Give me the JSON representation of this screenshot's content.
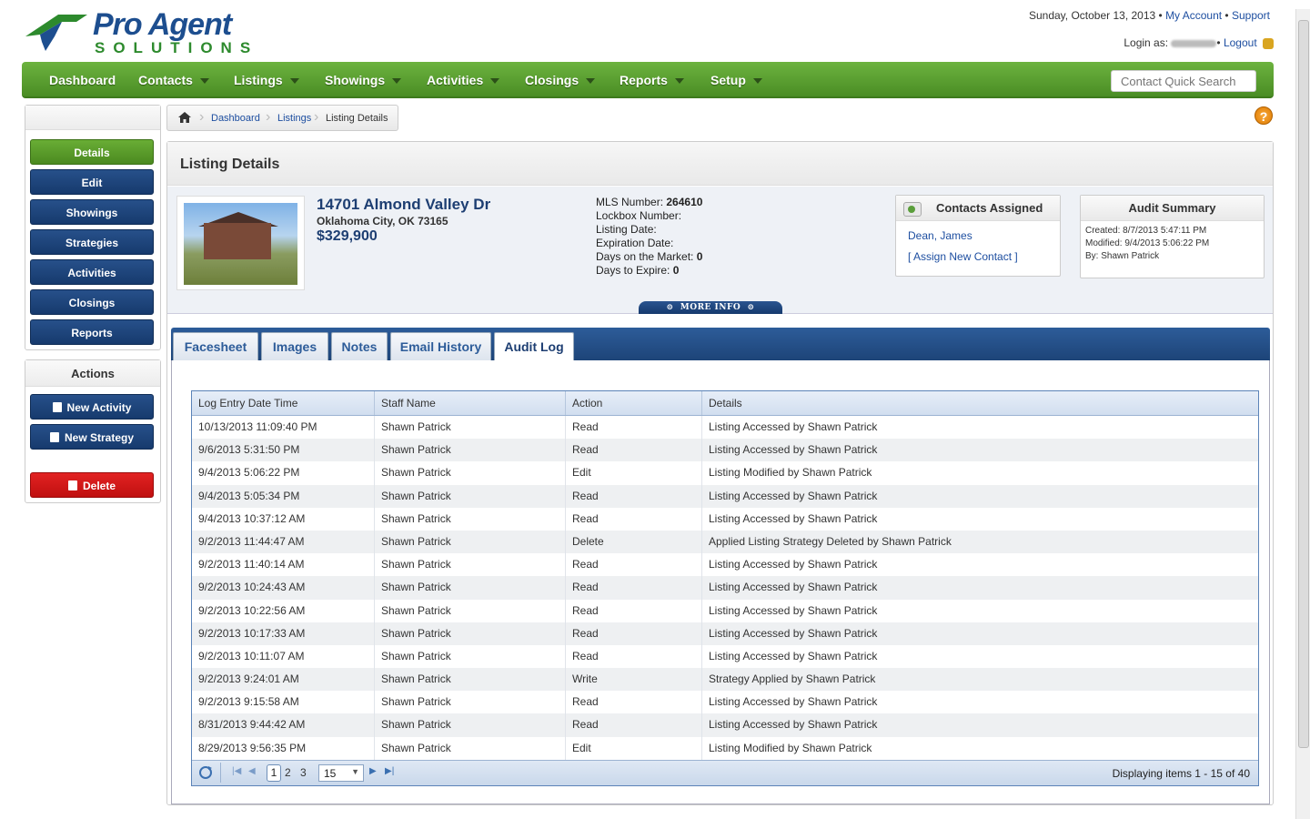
{
  "brand": {
    "line1": "Pro Agent",
    "line2": "SOLUTIONS"
  },
  "topbar": {
    "date": "Sunday, October 13, 2013",
    "my_account": "My Account",
    "support": "Support",
    "login_as": "Login as:",
    "logout": "Logout"
  },
  "nav": {
    "items": [
      {
        "label": "Dashboard"
      },
      {
        "label": "Contacts"
      },
      {
        "label": "Listings"
      },
      {
        "label": "Showings"
      },
      {
        "label": "Activities"
      },
      {
        "label": "Closings"
      },
      {
        "label": "Reports"
      },
      {
        "label": "Setup"
      }
    ],
    "search_placeholder": "Contact Quick Search"
  },
  "sidebar": {
    "items": [
      {
        "label": "Details"
      },
      {
        "label": "Edit"
      },
      {
        "label": "Showings"
      },
      {
        "label": "Strategies"
      },
      {
        "label": "Activities"
      },
      {
        "label": "Closings"
      },
      {
        "label": "Reports"
      }
    ]
  },
  "actions": {
    "title": "Actions",
    "new_activity": "New Activity",
    "new_strategy": "New Strategy",
    "delete": "Delete"
  },
  "breadcrumb": {
    "dashboard": "Dashboard",
    "listings": "Listings",
    "current": "Listing Details"
  },
  "help": "?",
  "panel": {
    "title": "Listing Details"
  },
  "listing": {
    "address": "14701 Almond Valley Dr",
    "city": "Oklahoma City, OK 73165",
    "price": "$329,900",
    "mls_label": "MLS Number:",
    "mls_value": "264610",
    "lockbox_label": "Lockbox Number:",
    "listing_date_label": "Listing Date:",
    "expiration_label": "Expiration Date:",
    "dom_label": "Days on the Market:",
    "dom_value": "0",
    "dte_label": "Days to Expire:",
    "dte_value": "0",
    "more_info": "MORE INFO"
  },
  "contacts": {
    "title": "Contacts Assigned",
    "contact": "Dean, James",
    "assign": "[ Assign New Contact ]"
  },
  "audit": {
    "title": "Audit Summary",
    "created": "Created: 8/7/2013 5:47:11 PM",
    "modified": "Modified: 9/4/2013 5:06:22 PM",
    "by": "By: Shawn Patrick"
  },
  "tabs": [
    {
      "label": "Facesheet"
    },
    {
      "label": "Images"
    },
    {
      "label": "Notes"
    },
    {
      "label": "Email History"
    },
    {
      "label": "Audit Log"
    }
  ],
  "grid": {
    "headers": [
      "Log Entry Date Time",
      "Staff Name",
      "Action",
      "Details"
    ],
    "rows": [
      [
        "10/13/2013 11:09:40 PM",
        "Shawn Patrick",
        "Read",
        "Listing Accessed by Shawn Patrick"
      ],
      [
        "9/6/2013 5:31:50 PM",
        "Shawn Patrick",
        "Read",
        "Listing Accessed by Shawn Patrick"
      ],
      [
        "9/4/2013 5:06:22 PM",
        "Shawn Patrick",
        "Edit",
        "Listing Modified by Shawn Patrick"
      ],
      [
        "9/4/2013 5:05:34 PM",
        "Shawn Patrick",
        "Read",
        "Listing Accessed by Shawn Patrick"
      ],
      [
        "9/4/2013 10:37:12 AM",
        "Shawn Patrick",
        "Read",
        "Listing Accessed by Shawn Patrick"
      ],
      [
        "9/2/2013 11:44:47 AM",
        "Shawn Patrick",
        "Delete",
        "Applied Listing Strategy Deleted by Shawn Patrick"
      ],
      [
        "9/2/2013 11:40:14 AM",
        "Shawn Patrick",
        "Read",
        "Listing Accessed by Shawn Patrick"
      ],
      [
        "9/2/2013 10:24:43 AM",
        "Shawn Patrick",
        "Read",
        "Listing Accessed by Shawn Patrick"
      ],
      [
        "9/2/2013 10:22:56 AM",
        "Shawn Patrick",
        "Read",
        "Listing Accessed by Shawn Patrick"
      ],
      [
        "9/2/2013 10:17:33 AM",
        "Shawn Patrick",
        "Read",
        "Listing Accessed by Shawn Patrick"
      ],
      [
        "9/2/2013 10:11:07 AM",
        "Shawn Patrick",
        "Read",
        "Listing Accessed by Shawn Patrick"
      ],
      [
        "9/2/2013 9:24:01 AM",
        "Shawn Patrick",
        "Write",
        "Strategy Applied by Shawn Patrick"
      ],
      [
        "9/2/2013 9:15:58 AM",
        "Shawn Patrick",
        "Read",
        "Listing Accessed by Shawn Patrick"
      ],
      [
        "8/31/2013 9:44:42 AM",
        "Shawn Patrick",
        "Read",
        "Listing Accessed by Shawn Patrick"
      ],
      [
        "8/29/2013 9:56:35 PM",
        "Shawn Patrick",
        "Edit",
        "Listing Modified by Shawn Patrick"
      ]
    ],
    "pager": {
      "pages": [
        "1",
        "2",
        "3"
      ],
      "page_size": "15",
      "display": "Displaying items 1 - 15 of 40"
    }
  }
}
